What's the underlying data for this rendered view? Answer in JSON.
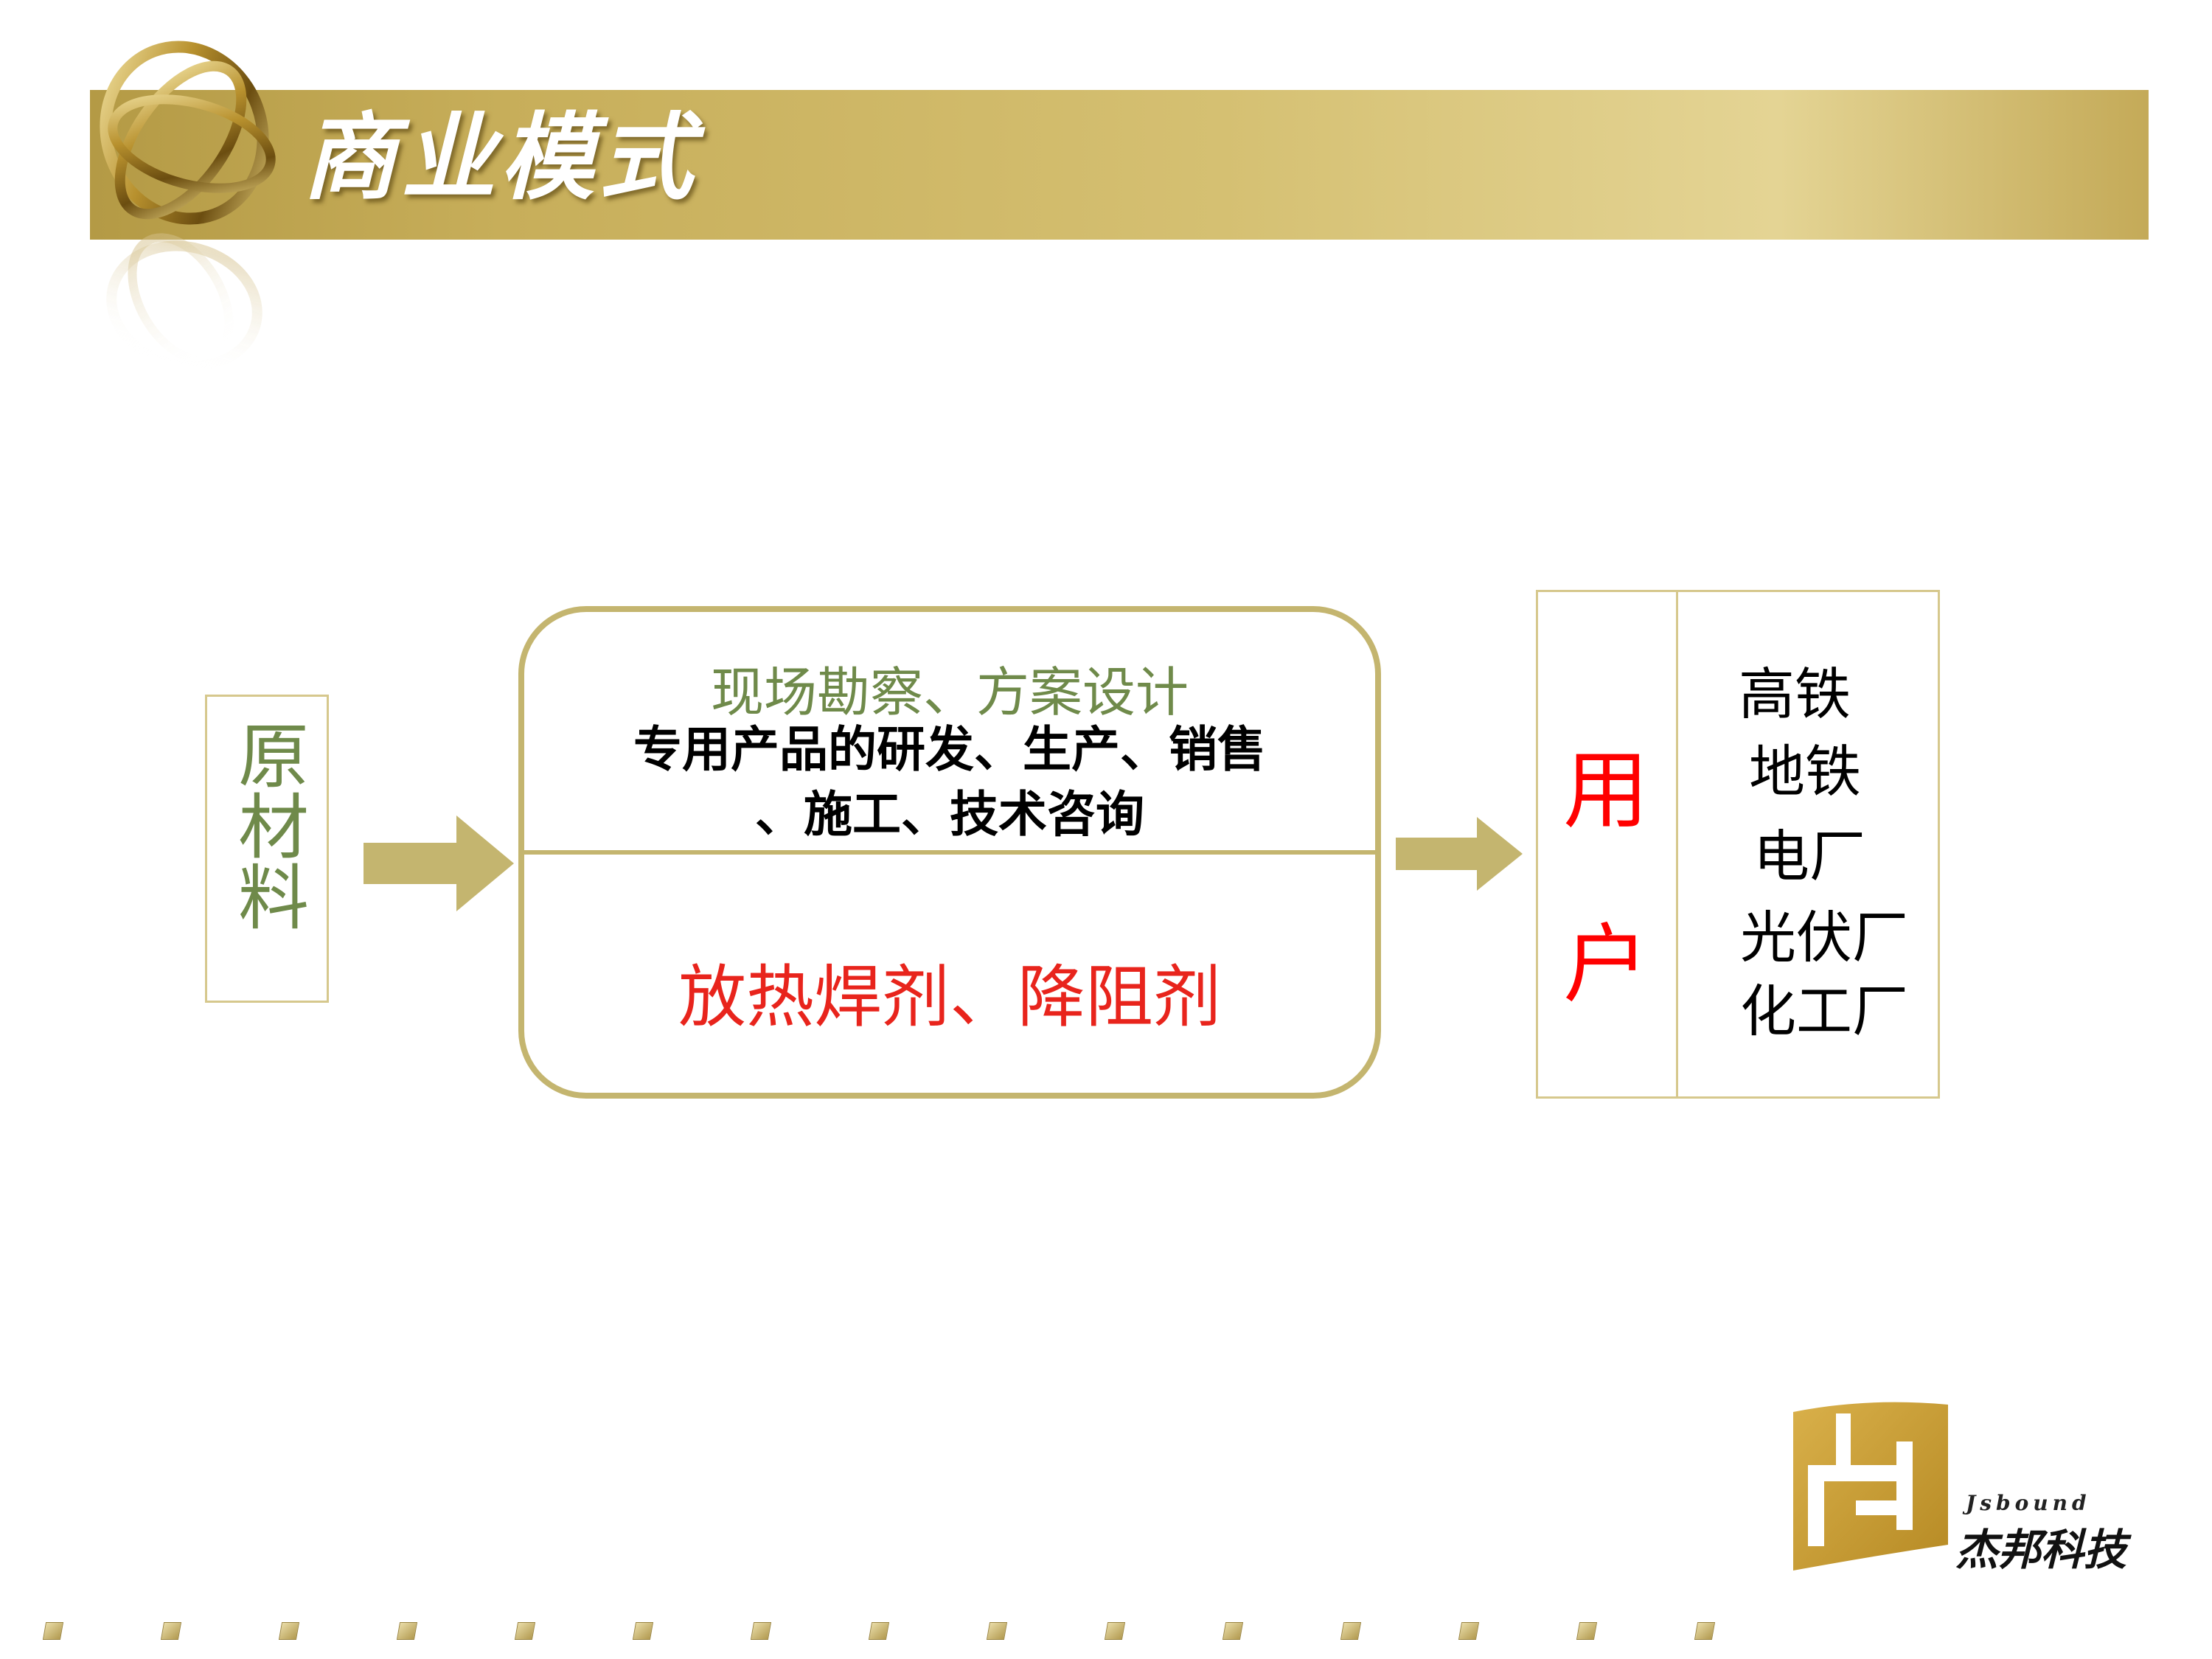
{
  "header": {
    "title": "商业模式"
  },
  "diagram": {
    "raw_materials": "原材料",
    "services": {
      "survey": "现场勘察、方案设计",
      "line1": "专用产品的研发、生产、销售",
      "line2": "、施工、技术咨询"
    },
    "products": "放热焊剂、降阻剂",
    "user": {
      "label_top": "用",
      "label_bottom": "户",
      "items": [
        "高铁",
        "地铁",
        "电厂",
        "光伏厂",
        "化工厂"
      ]
    }
  },
  "company": {
    "name_en": "Jsbound",
    "name_cn": "杰邦科技"
  },
  "colors": {
    "band": "#c9b265",
    "olive_text": "#6f8a4a",
    "red_text": "#e8241c",
    "user_red": "#ff0000",
    "border": "#c4b56f"
  }
}
